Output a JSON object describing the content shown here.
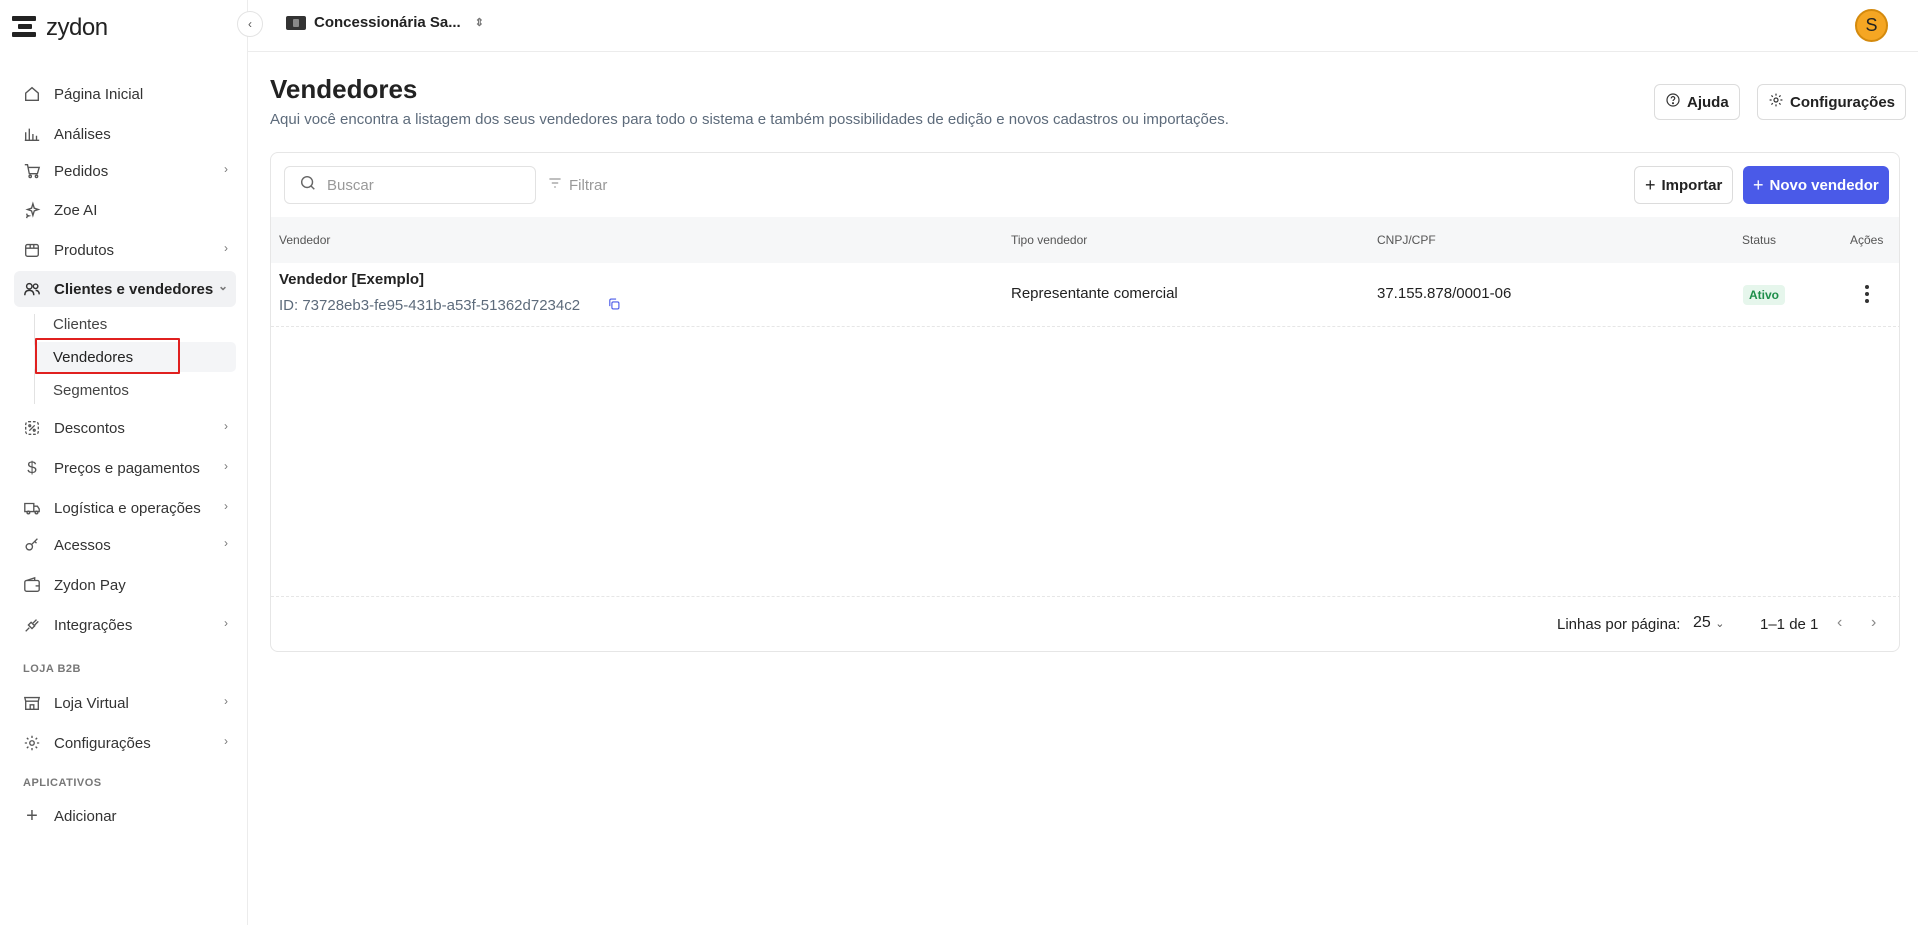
{
  "brand": {
    "name": "zydon"
  },
  "topbar": {
    "company": "Concessionária Sa...",
    "avatar_initial": "S"
  },
  "sidebar": {
    "items": [
      {
        "label": "Página Inicial",
        "icon": "home-icon"
      },
      {
        "label": "Análises",
        "icon": "chart-icon"
      },
      {
        "label": "Pedidos",
        "icon": "cart-icon"
      },
      {
        "label": "Zoe AI",
        "icon": "sparkle-icon"
      },
      {
        "label": "Produtos",
        "icon": "box-icon"
      },
      {
        "label": "Clientes e vendedores",
        "icon": "users-icon"
      },
      {
        "label": "Descontos",
        "icon": "discount-icon"
      },
      {
        "label": "Preços e pagamentos",
        "icon": "dollar-icon"
      },
      {
        "label": "Logística e operações",
        "icon": "truck-icon"
      },
      {
        "label": "Acessos",
        "icon": "key-icon"
      },
      {
        "label": "Zydon Pay",
        "icon": "wallet-icon"
      },
      {
        "label": "Integrações",
        "icon": "plug-icon"
      },
      {
        "label": "Loja Virtual",
        "icon": "store-icon"
      },
      {
        "label": "Configurações",
        "icon": "gear-icon"
      },
      {
        "label": "Adicionar",
        "icon": "plus-icon"
      }
    ],
    "subitems": [
      "Clientes",
      "Vendedores",
      "Segmentos"
    ],
    "sections": [
      "LOJA B2B",
      "APLICATIVOS"
    ]
  },
  "page": {
    "title": "Vendedores",
    "description": "Aqui você encontra a listagem dos seus vendedores para todo o sistema e também possibilidades de edição e novos cadastros ou importações.",
    "help_label": "Ajuda",
    "settings_label": "Configurações"
  },
  "toolbar": {
    "search_placeholder": "Buscar",
    "filter_label": "Filtrar",
    "import_label": "Importar",
    "new_label": "Novo vendedor"
  },
  "table": {
    "headers": [
      "Vendedor",
      "Tipo vendedor",
      "CNPJ/CPF",
      "Status",
      "Ações"
    ],
    "rows": [
      {
        "name": "Vendedor [Exemplo]",
        "id": "ID: 73728eb3-fe95-431b-a53f-51362d7234c2",
        "type": "Representante comercial",
        "doc": "37.155.878/0001-06",
        "status": "Ativo"
      }
    ]
  },
  "pagination": {
    "rows_label": "Linhas por página:",
    "rows_value": "25",
    "range": "1–1 de 1"
  },
  "colors": {
    "primary": "#4a5ae8",
    "active_green": "#1e8e4a",
    "highlight_red": "#e0201f",
    "avatar": "#f5a623"
  }
}
